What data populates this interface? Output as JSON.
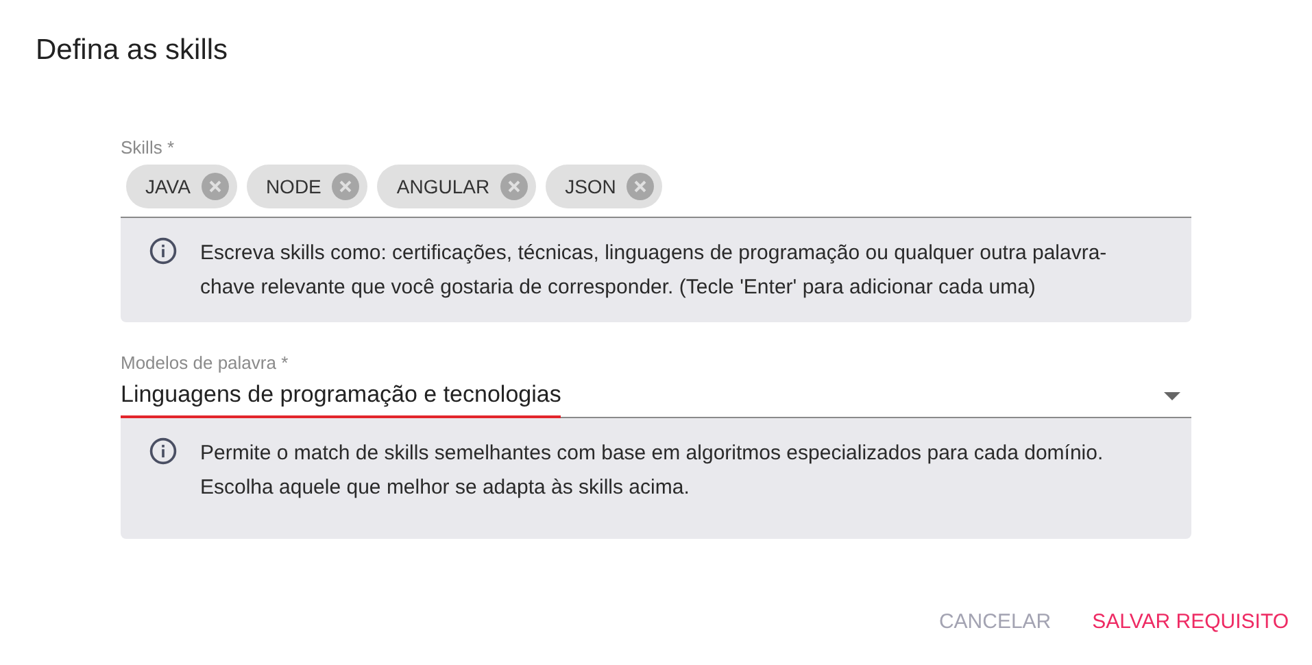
{
  "dialog": {
    "title": "Defina as skills"
  },
  "skills_field": {
    "label": "Skills *",
    "chips": [
      "JAVA",
      "NODE",
      "ANGULAR",
      "JSON"
    ],
    "hint": "Escreva skills como: certificações, técnicas, linguagens de programação ou qualquer outra palavra-chave relevante que você gostaria de corresponder. (Tecle 'Enter' para adicionar cada uma)"
  },
  "model_select": {
    "label": "Modelos de palavra *",
    "value": "Linguagens de programação e tecnologias",
    "value_underlined": true,
    "hint": "Permite o match de skills semelhantes com base em algoritmos especializados para cada domínio. Escolha aquele que melhor se adapta às skills acima."
  },
  "buttons": [
    {
      "label": "CANCELAR",
      "kind": "secondary"
    },
    {
      "label": "SALVAR REQUISITO",
      "kind": "primary"
    }
  ]
}
